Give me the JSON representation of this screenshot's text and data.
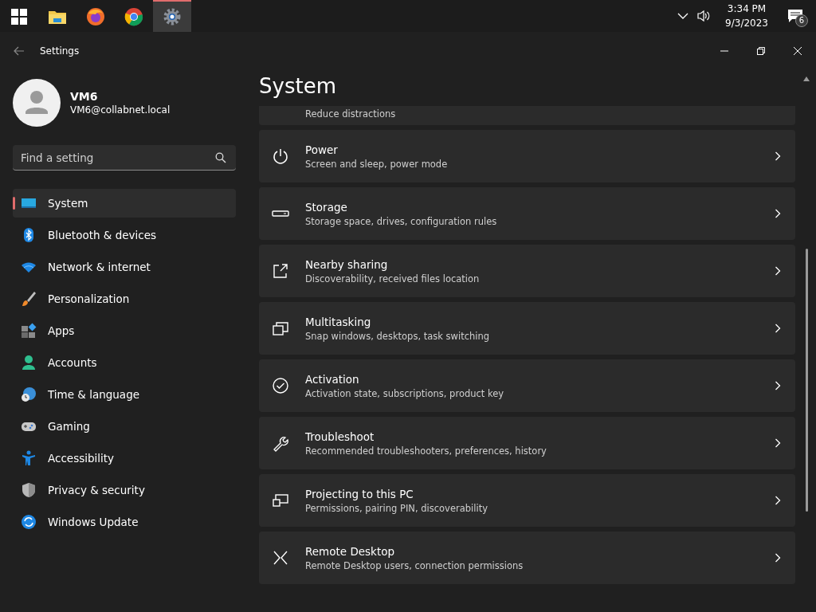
{
  "taskbar": {
    "apps": [
      {
        "selected": false
      },
      {
        "selected": false
      },
      {
        "selected": false
      },
      {
        "selected": true
      }
    ],
    "clock": {
      "time": "3:34 PM",
      "date": "9/3/2023"
    },
    "notifications": "6"
  },
  "window": {
    "title": "Settings"
  },
  "profile": {
    "name": "VM6",
    "email": "VM6@collabnet.local"
  },
  "search": {
    "placeholder": "Find a setting"
  },
  "sidebar": {
    "items": [
      {
        "label": "System",
        "selected": true
      },
      {
        "label": "Bluetooth & devices",
        "selected": false
      },
      {
        "label": "Network & internet",
        "selected": false
      },
      {
        "label": "Personalization",
        "selected": false
      },
      {
        "label": "Apps",
        "selected": false
      },
      {
        "label": "Accounts",
        "selected": false
      },
      {
        "label": "Time & language",
        "selected": false
      },
      {
        "label": "Gaming",
        "selected": false
      },
      {
        "label": "Accessibility",
        "selected": false
      },
      {
        "label": "Privacy & security",
        "selected": false
      },
      {
        "label": "Windows Update",
        "selected": false
      }
    ]
  },
  "page": {
    "heading": "System",
    "partial_item": {
      "subtitle": "Reduce distractions"
    },
    "items": [
      {
        "title": "Power",
        "subtitle": "Screen and sleep, power mode"
      },
      {
        "title": "Storage",
        "subtitle": "Storage space, drives, configuration rules"
      },
      {
        "title": "Nearby sharing",
        "subtitle": "Discoverability, received files location"
      },
      {
        "title": "Multitasking",
        "subtitle": "Snap windows, desktops, task switching"
      },
      {
        "title": "Activation",
        "subtitle": "Activation state, subscriptions, product key"
      },
      {
        "title": "Troubleshoot",
        "subtitle": "Recommended troubleshooters, preferences, history"
      },
      {
        "title": "Projecting to this PC",
        "subtitle": "Permissions, pairing PIN, discoverability"
      },
      {
        "title": "Remote Desktop",
        "subtitle": "Remote Desktop users, connection permissions"
      }
    ]
  }
}
